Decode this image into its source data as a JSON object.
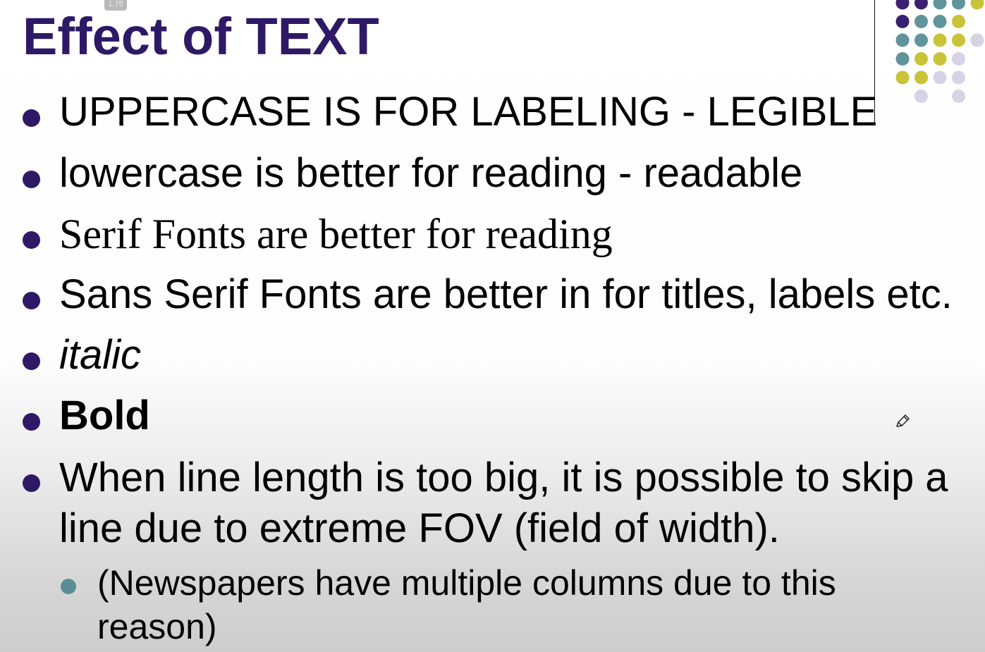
{
  "badge": "1.75",
  "title": "Effect of TEXT",
  "bullets": [
    {
      "text": "UPPERCASE IS FOR LABELING - LEGIBLE"
    },
    {
      "text": "lowercase is better for reading - readable"
    },
    {
      "text": "Serif Fonts are better for reading"
    },
    {
      "text": "Sans Serif Fonts are better in for titles, labels etc."
    },
    {
      "text": "italic"
    },
    {
      "text": "Bold"
    },
    {
      "line1": "When line length is too big, it is possible to skip a",
      "line2": "line due to extreme FOV (field of width)."
    }
  ],
  "sub_bullet": {
    "line1": " (Newspapers have multiple columns due to this",
    "line2": "reason)"
  },
  "colors": {
    "title": "#2e1966",
    "bullet": "#2e1966",
    "sub_bullet": "#5b8e94",
    "dot_purple": "#3b1f70",
    "dot_teal": "#5f949a",
    "dot_yellow": "#c9c337",
    "dot_lavender": "#d6d3e6"
  },
  "icons": {
    "cursor": "pencil-icon"
  }
}
